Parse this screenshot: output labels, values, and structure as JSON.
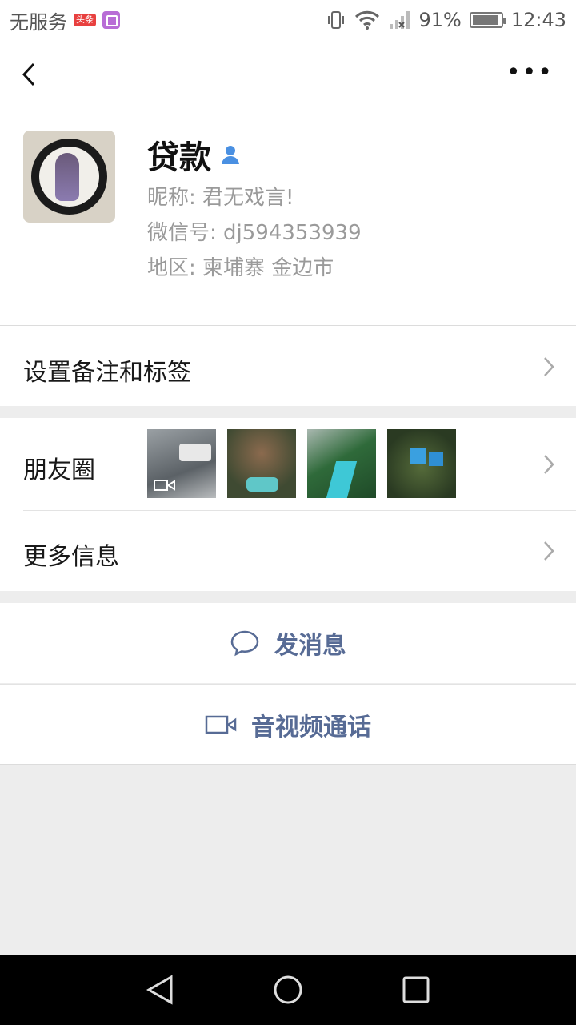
{
  "status_bar": {
    "carrier": "无服务",
    "badge_text": "头条",
    "battery_percent": "91%",
    "battery_level": 0.91,
    "time": "12:43"
  },
  "header": {
    "back_icon": "chevron-left-icon",
    "more_icon": "more-dots-icon",
    "more_label": "•••"
  },
  "profile": {
    "name": "贷款",
    "nickname": "昵称:  君无戏言!",
    "wechat_id": "微信号:  dj594353939",
    "region": "地区:  柬埔寨  金边市"
  },
  "menu": {
    "remark_label": "设置备注和标签",
    "moments_label": "朋友圈",
    "more_info_label": "更多信息"
  },
  "actions": {
    "message_label": "发消息",
    "call_label": "音视频通话"
  },
  "colors": {
    "link": "#576b95",
    "background": "#ededed",
    "verify_icon": "#4a90e2"
  }
}
